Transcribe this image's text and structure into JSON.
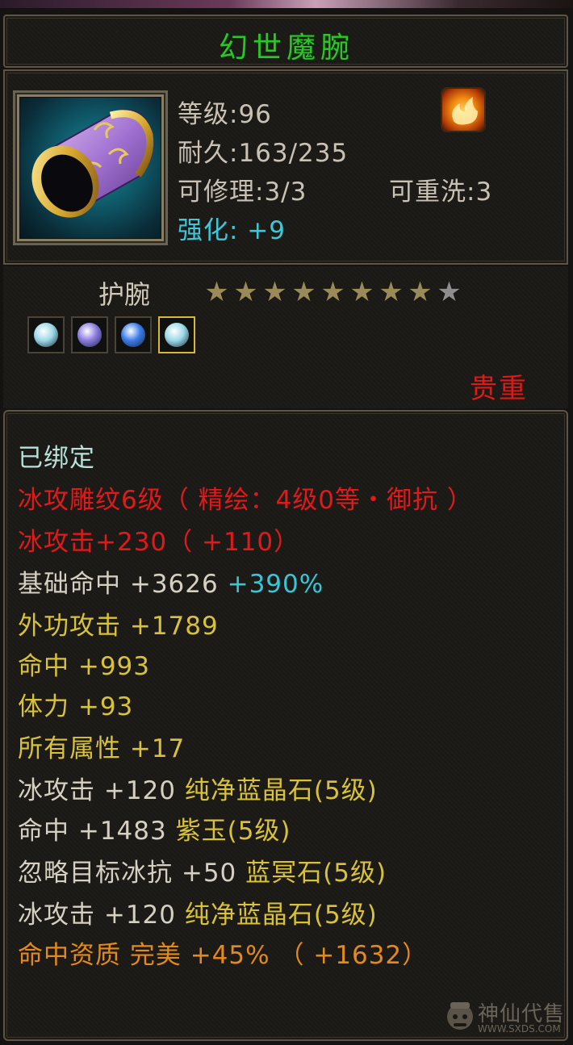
{
  "item": {
    "name": "幻世魔腕",
    "level": "等级:96",
    "durability": "耐久:163/235",
    "repairable": "可修理:3/3",
    "rewash": "可重洗:3",
    "enhance": "强化: +9",
    "type": "护腕",
    "stars_filled": 8,
    "stars_total": 9,
    "rarity": "贵重"
  },
  "gems": [
    {
      "icon": "light-blue-gem-icon",
      "color": "#9ad8e8"
    },
    {
      "icon": "purple-gem-icon",
      "color": "#8a7ae0"
    },
    {
      "icon": "blue-gem-icon",
      "color": "#3a7ae8"
    },
    {
      "icon": "light-blue-gem-icon",
      "color": "#9ad8e8"
    }
  ],
  "attributes": {
    "bound": "已绑定",
    "engrave": "冰攻雕纹6级（ 精绘：4级0等・御抗 ）",
    "ice_attack": "冰攻击+230（ +110）",
    "base_hit_label": "基础命中 +3626",
    "base_hit_bonus": "+390%",
    "outer_attack": "外功攻击 +1789",
    "hit": "命中 +993",
    "stamina": "体力 +93",
    "all_attr": "所有属性 +17",
    "gem1_stat": "冰攻击 +120",
    "gem1_name": "纯净蓝晶石(5级)",
    "gem2_stat": "命中 +1483",
    "gem2_name": "紫玉(5级)",
    "gem3_stat": "忽略目标冰抗 +50",
    "gem3_name": "蓝冥石(5级)",
    "gem4_stat": "冰攻击 +120",
    "gem4_name": "纯净蓝晶石(5级)",
    "aptitude": "命中资质  完美 +45% （ +1632）"
  },
  "watermark": {
    "text": "神仙代售",
    "url": "WWW.SXDS.COM"
  },
  "colors": {
    "title_green": "#2ec42a",
    "red": "#e01a1a",
    "cyan": "#36c6d6",
    "yellow": "#d8c23a",
    "orange": "#e48a1a"
  }
}
